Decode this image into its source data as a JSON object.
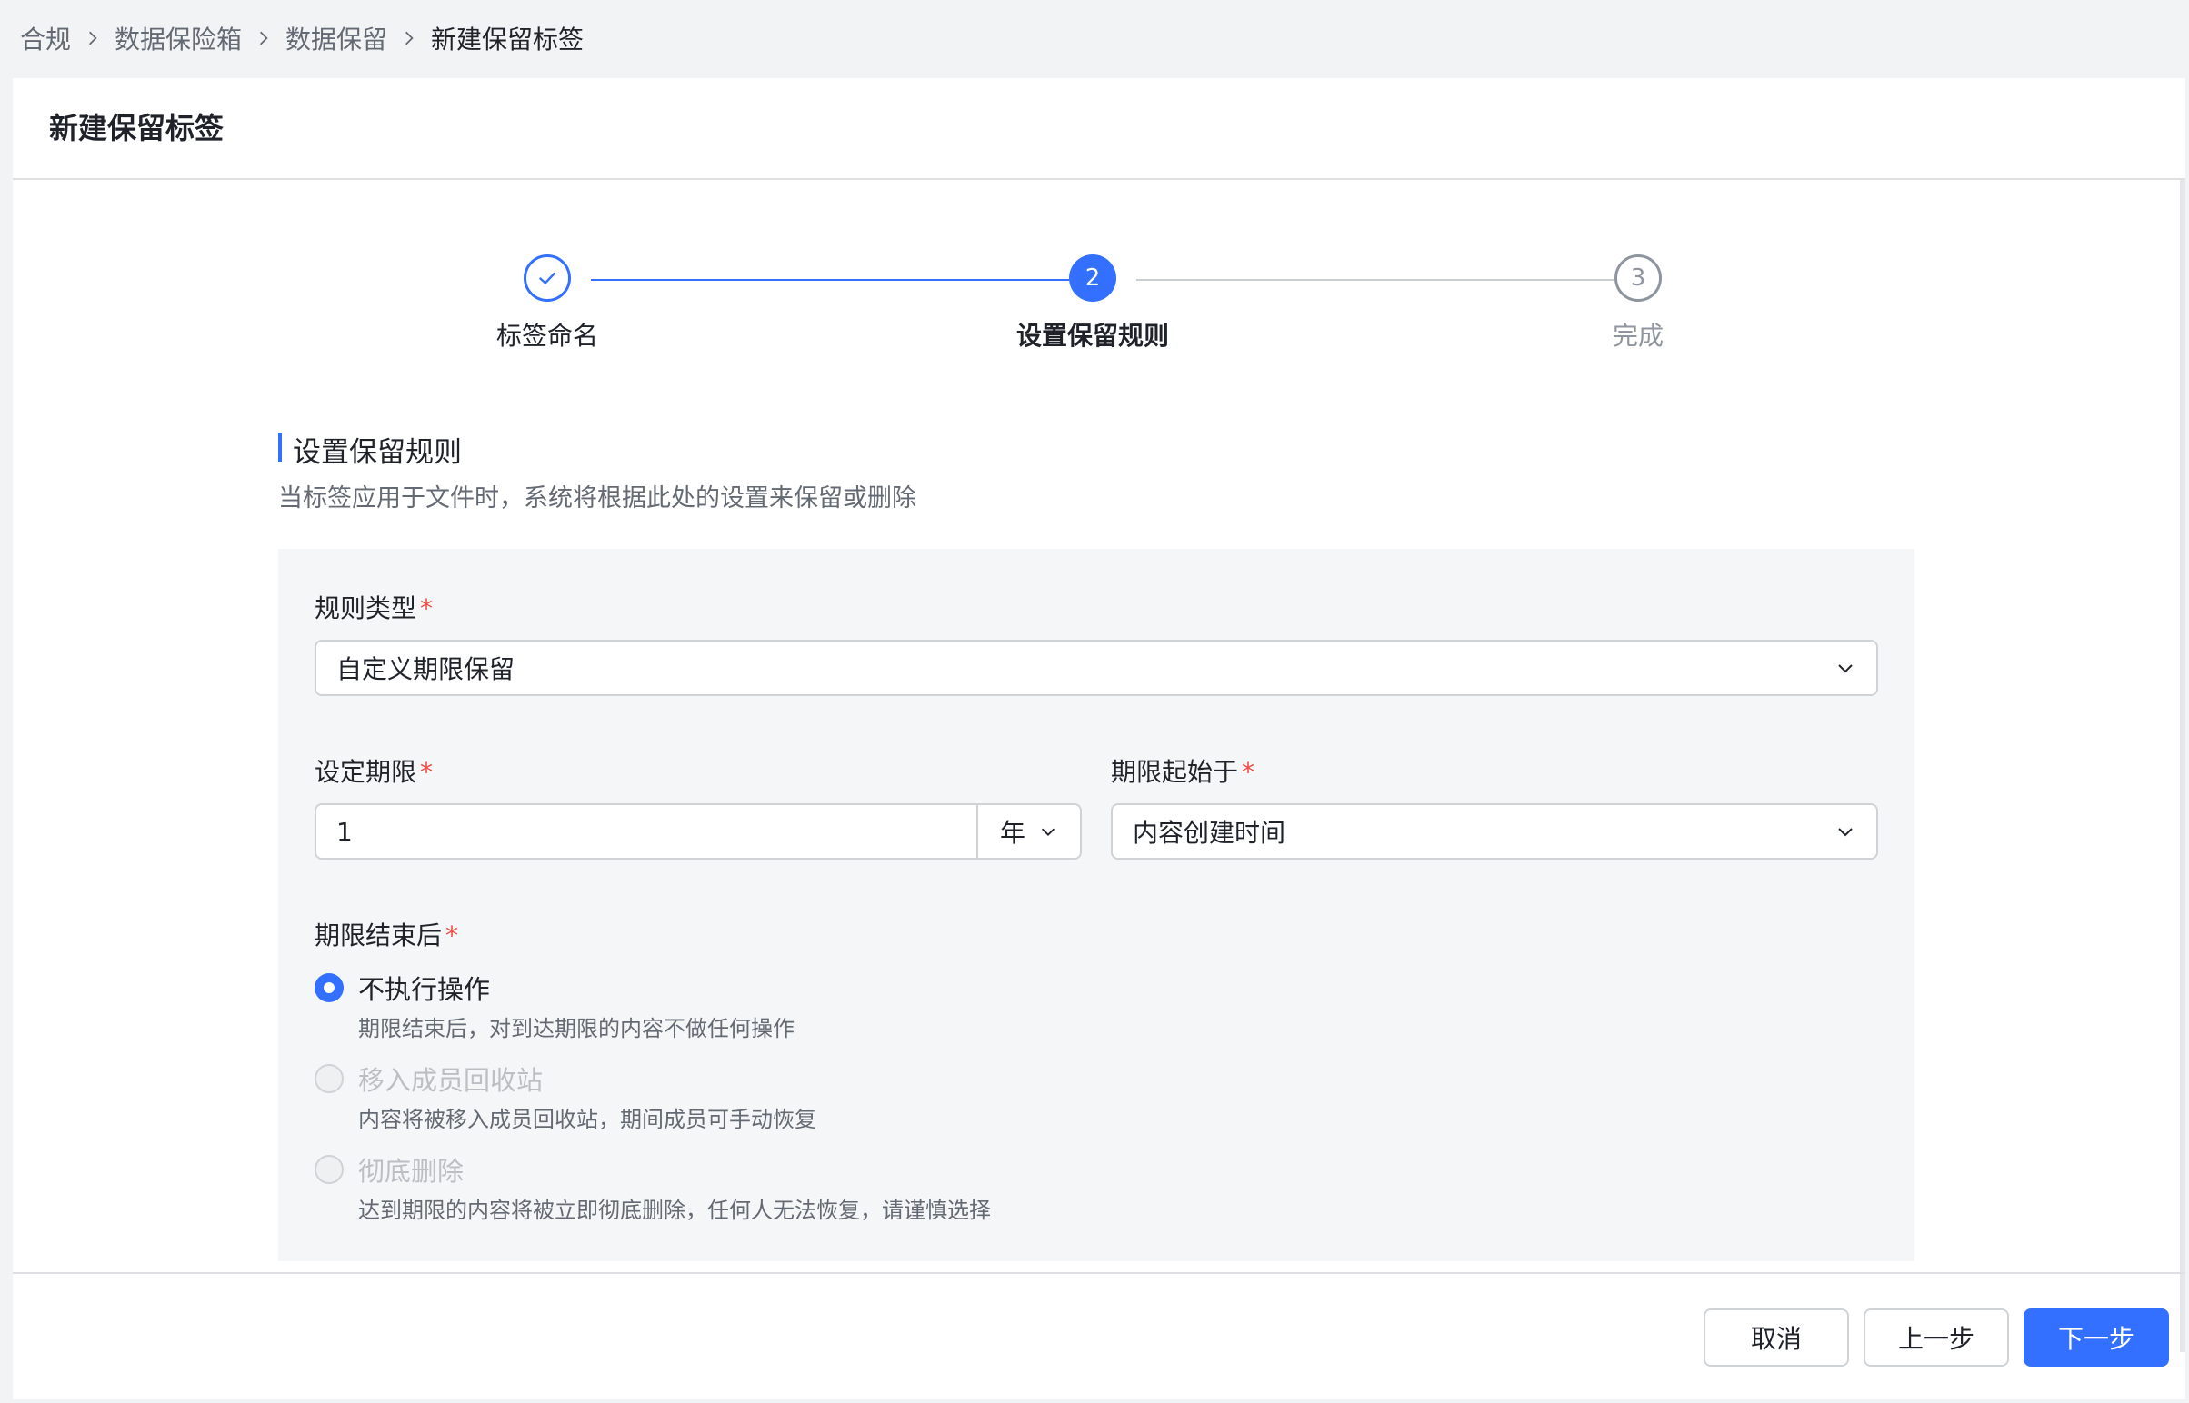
{
  "breadcrumb": {
    "items": [
      "合规",
      "数据保险箱",
      "数据保留",
      "新建保留标签"
    ]
  },
  "page_title": "新建保留标签",
  "stepper": {
    "steps": [
      {
        "label": "标签命名",
        "status": "done",
        "icon": "check-icon"
      },
      {
        "label": "设置保留规则",
        "status": "active",
        "number": "2"
      },
      {
        "label": "完成",
        "status": "todo",
        "number": "3"
      }
    ]
  },
  "section": {
    "title": "设置保留规则",
    "description": "当标签应用于文件时，系统将根据此处的设置来保留或删除"
  },
  "form": {
    "rule_type": {
      "label": "规则类型",
      "required_mark": "*",
      "value": "自定义期限保留"
    },
    "period": {
      "label": "设定期限",
      "required_mark": "*",
      "value": "1",
      "unit": "年"
    },
    "period_start": {
      "label": "期限起始于",
      "required_mark": "*",
      "value": "内容创建时间"
    },
    "after_period": {
      "label": "期限结束后",
      "required_mark": "*",
      "options": [
        {
          "label": "不执行操作",
          "description": "期限结束后，对到达期限的内容不做任何操作",
          "checked": true,
          "disabled": false
        },
        {
          "label": "移入成员回收站",
          "description": "内容将被移入成员回收站，期间成员可手动恢复",
          "checked": false,
          "disabled": true
        },
        {
          "label": "彻底删除",
          "description": "达到期限的内容将被立即彻底删除，任何人无法恢复，请谨慎选择",
          "checked": false,
          "disabled": true
        }
      ]
    }
  },
  "footer": {
    "cancel_label": "取消",
    "prev_label": "上一步",
    "next_label": "下一步"
  },
  "colors": {
    "primary": "#3370ff",
    "required": "#f54a45",
    "panel_bg": "#f5f6f7"
  }
}
